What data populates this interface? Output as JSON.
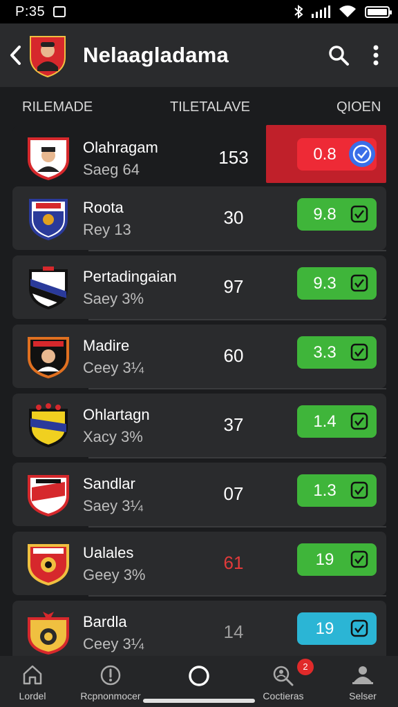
{
  "status": {
    "time": "P:35"
  },
  "appbar": {
    "title": "Nelaagladama",
    "back_icon": "chevron-left-icon",
    "search_icon": "search-icon",
    "more_icon": "more-vertical-icon"
  },
  "columns": {
    "left": "RILEMADE",
    "middle": "TILETALAVE",
    "right": "QIOEN"
  },
  "colors": {
    "green": "#3fb53a",
    "red": "#ee2a36",
    "teal": "#2bb5d5",
    "highlight": "#c0202a"
  },
  "rows": [
    {
      "name": "Olahragam",
      "sub": "Saeg 64",
      "num": "153",
      "value": "0.8",
      "state": "red",
      "check": "blue-check-circle-icon"
    },
    {
      "name": "Roota",
      "sub": "Rey 13",
      "num": "30",
      "value": "9.8",
      "state": "green",
      "check": "check-square-icon"
    },
    {
      "name": "Pertadingaian",
      "sub": "Saey 3%",
      "num": "97",
      "value": "9.3",
      "state": "green",
      "check": "check-square-icon"
    },
    {
      "name": "Madire",
      "sub": "Ceey 3¼",
      "num": "60",
      "value": "3.3",
      "state": "green",
      "check": "check-square-icon"
    },
    {
      "name": "Ohlartagn",
      "sub": "Xacy 3%",
      "num": "37",
      "value": "1.4",
      "state": "green",
      "check": "check-square-icon"
    },
    {
      "name": "Sandlar",
      "sub": "Saey 3¼",
      "num": "07",
      "value": "1.3",
      "state": "green",
      "check": "check-square-icon"
    },
    {
      "name": "Ualales",
      "sub": "Geey 3%",
      "num": "61",
      "value": "19",
      "state": "green",
      "check": "check-square-icon"
    },
    {
      "name": "Bardla",
      "sub": "Ceey 3¼",
      "num": "14",
      "value": "19",
      "state": "teal",
      "check": "check-square-icon"
    }
  ],
  "nav": [
    {
      "label": "Lordel",
      "icon": "home-icon"
    },
    {
      "label": "Rcpnonmocer",
      "icon": "alert-circle-icon"
    },
    {
      "label": "",
      "icon": "circle-button-icon"
    },
    {
      "label": "Coctieras",
      "icon": "search-people-icon",
      "badge": "2"
    },
    {
      "label": "Selser",
      "icon": "profile-icon"
    }
  ]
}
